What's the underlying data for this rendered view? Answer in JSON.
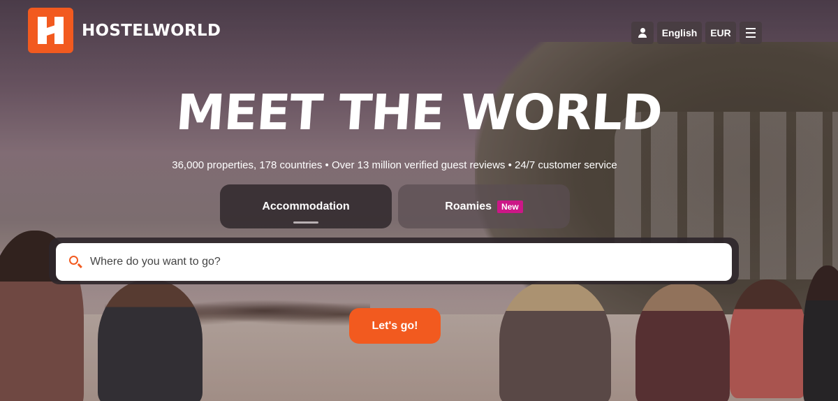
{
  "brand": {
    "name": "HOSTELWORLD",
    "accent": "#f25a1f",
    "badge_color": "#cc1787"
  },
  "nav": {
    "user_icon": "user-icon",
    "language": "English",
    "currency": "EUR",
    "menu_icon": "hamburger-menu-icon"
  },
  "hero": {
    "headline": "MEET THE WORLD",
    "subline": "36,000 properties, 178 countries • Over 13 million verified guest reviews • 24/7 customer service"
  },
  "tabs": [
    {
      "label": "Accommodation",
      "selected": true
    },
    {
      "label": "Roamies",
      "badge": "New",
      "selected": false
    }
  ],
  "search": {
    "placeholder": "Where do you want to go?",
    "value": "",
    "icon": "search-icon"
  },
  "cta": {
    "label": "Let's go!"
  }
}
